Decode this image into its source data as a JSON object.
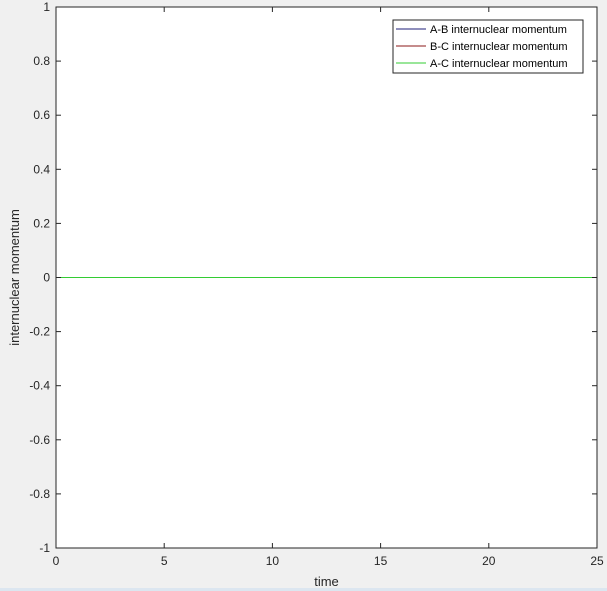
{
  "chart_data": {
    "type": "line",
    "title": "",
    "xlabel": "time",
    "ylabel": "internuclear momentum",
    "xlim": [
      0,
      25
    ],
    "ylim": [
      -1,
      1
    ],
    "xticks": [
      0,
      5,
      10,
      15,
      20,
      25
    ],
    "yticks": [
      -1,
      -0.8,
      -0.6,
      -0.4,
      -0.2,
      0,
      0.2,
      0.4,
      0.6,
      0.8,
      1
    ],
    "xtick_labels": [
      "0",
      "5",
      "10",
      "15",
      "20",
      "25"
    ],
    "ytick_labels": [
      "-1",
      "-0.8",
      "-0.6",
      "-0.4",
      "-0.2",
      "0",
      "0.2",
      "0.4",
      "0.6",
      "0.8",
      "1"
    ],
    "grid": false,
    "legend_position": "top-right",
    "x": [
      0,
      25
    ],
    "series": [
      {
        "name": "A-B internuclear momentum",
        "color": "#1f1f7a",
        "values": [
          0,
          0
        ]
      },
      {
        "name": "B-C internuclear momentum",
        "color": "#8b1a1a",
        "values": [
          0,
          0
        ]
      },
      {
        "name": "A-C internuclear momentum",
        "color": "#33cc33",
        "values": [
          0,
          0
        ]
      }
    ]
  }
}
